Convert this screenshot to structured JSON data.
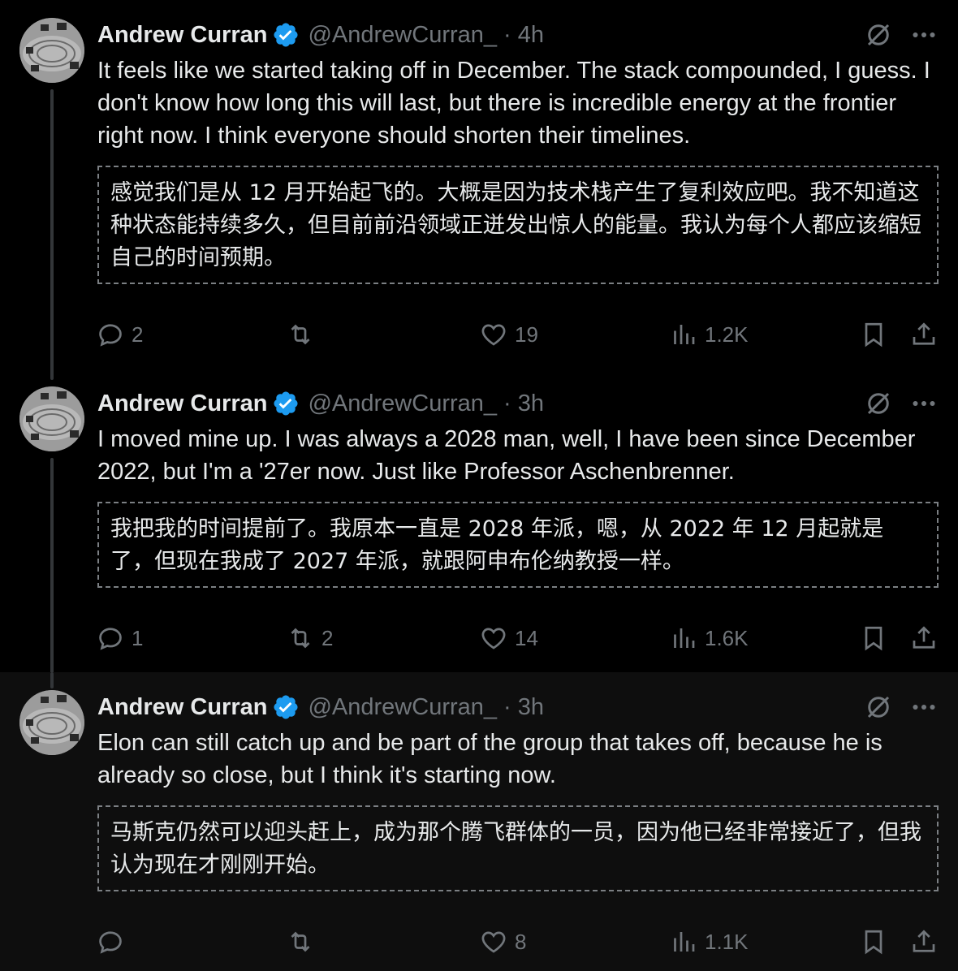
{
  "tweets": [
    {
      "name": "Andrew Curran",
      "handle": "@AndrewCurran_",
      "separator": "·",
      "time": "4h",
      "text": "It feels like we started taking off in December. The stack compounded, I guess. I don't know how long this will last, but there is incredible energy at the frontier right now. I think everyone should shorten their timelines.",
      "translation": "感觉我们是从 12 月开始起飞的。大概是因为技术栈产生了复利效应吧。我不知道这种状态能持续多久，但目前前沿领域正迸发出惊人的能量。我认为每个人都应该缩短自己的时间预期。",
      "replies": "2",
      "reposts": "",
      "likes": "19",
      "views": "1.2K"
    },
    {
      "name": "Andrew Curran",
      "handle": "@AndrewCurran_",
      "separator": "·",
      "time": "3h",
      "text": "I moved mine up. I was always a 2028 man, well, I have been since December 2022, but I'm a '27er now. Just like Professor Aschenbrenner.",
      "translation": "我把我的时间提前了。我原本一直是 2028 年派，嗯，从 2022 年 12 月起就是了，但现在我成了 2027 年派，就跟阿申布伦纳教授一样。",
      "replies": "1",
      "reposts": "2",
      "likes": "14",
      "views": "1.6K"
    },
    {
      "name": "Andrew Curran",
      "handle": "@AndrewCurran_",
      "separator": "·",
      "time": "3h",
      "text": "Elon can still catch up and be part of the group that takes off, because he is already so close, but I think it's starting now.",
      "translation": "马斯克仍然可以迎头赶上，成为那个腾飞群体的一员，因为他已经非常接近了，但我认为现在才刚刚开始。",
      "replies": "",
      "reposts": "",
      "likes": "8",
      "views": "1.1K"
    }
  ],
  "icons": {
    "verified": "verified-badge-icon",
    "grok": "grok-icon",
    "more": "more-icon",
    "reply": "reply-icon",
    "repost": "repost-icon",
    "like": "like-icon",
    "views": "views-icon",
    "bookmark": "bookmark-icon",
    "share": "share-icon"
  },
  "colors": {
    "background": "#000000",
    "highlight_background": "#0e0e0e",
    "text": "#e7e9ea",
    "muted": "#71767b",
    "verified": "#1d9bf0",
    "thread_line": "#333639"
  }
}
